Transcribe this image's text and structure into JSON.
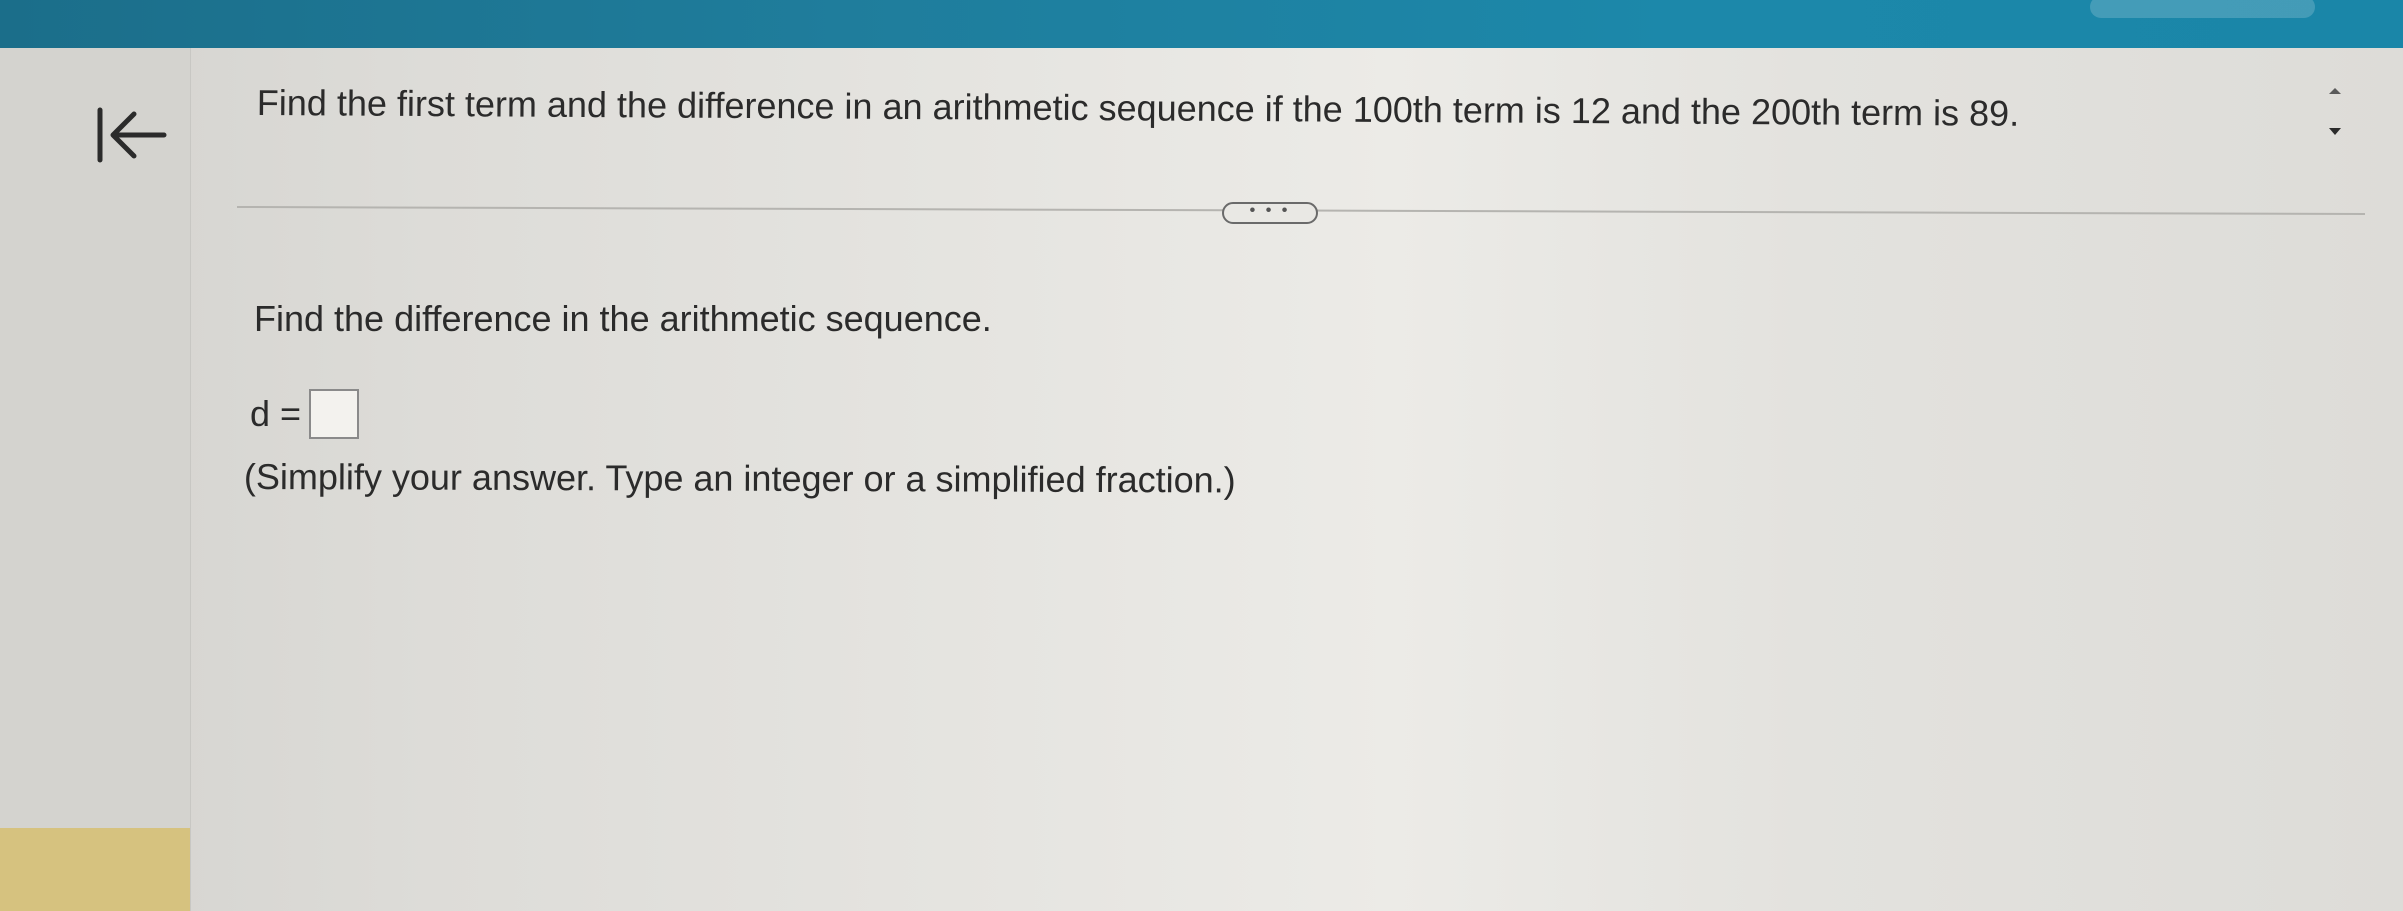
{
  "question": {
    "text": "Find the first term and the difference in an arithmetic sequence if the 100th term is 12 and the 200th term is 89."
  },
  "more_button": {
    "label": "• • •"
  },
  "part": {
    "prompt": "Find the difference in the arithmetic sequence.",
    "answer_label": "d =",
    "answer_value": "",
    "hint": "(Simplify your answer. Type an integer or a simplified fraction.)"
  },
  "icons": {
    "back": "back-to-start-arrow-icon",
    "scroll": "up-down-chevron-icon"
  },
  "colors": {
    "header": "#1c7fa0",
    "accent_panel": "#d6c27f",
    "text": "#2b2b2b"
  }
}
